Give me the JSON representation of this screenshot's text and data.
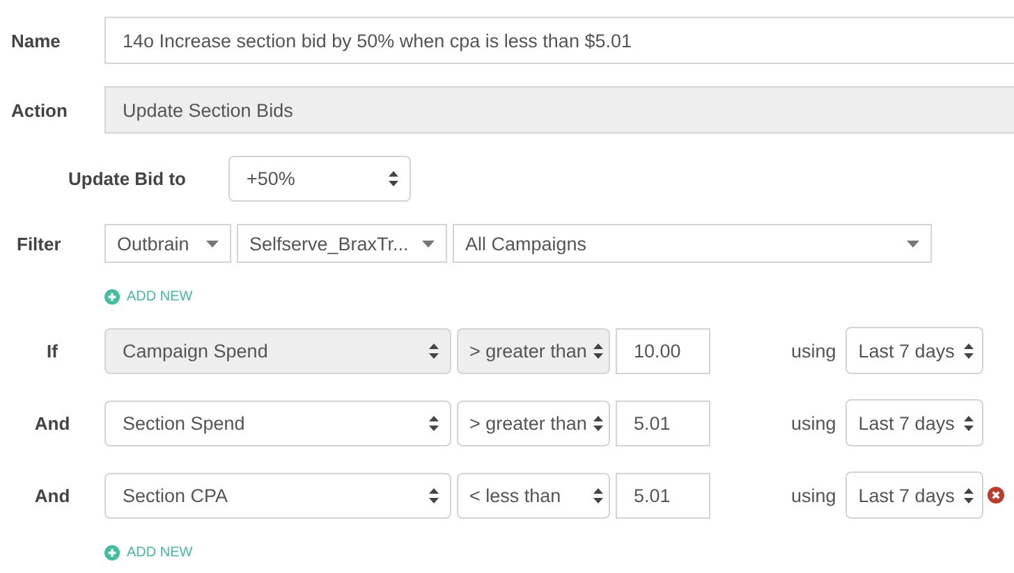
{
  "name": {
    "label": "Name",
    "value": "14o Increase section bid by 50% when cpa is less than $5.01"
  },
  "action": {
    "label": "Action",
    "value": "Update Section Bids",
    "disabled": true
  },
  "update_bid": {
    "label": "Update Bid to",
    "value": "+50%"
  },
  "filter": {
    "label": "Filter",
    "selects": [
      {
        "value": "Outbrain"
      },
      {
        "value": "Selfserve_BraxTr..."
      },
      {
        "value": "All Campaigns"
      }
    ],
    "add_new": "ADD NEW"
  },
  "conditions": [
    {
      "label": "If",
      "field": "Campaign Spend",
      "operator": "> greater than",
      "value": "10.00",
      "using": "using",
      "period": "Last 7 days",
      "disabled": true,
      "removable": false
    },
    {
      "label": "And",
      "field": "Section Spend",
      "operator": "> greater than",
      "value": "5.01",
      "using": "using",
      "period": "Last 7 days",
      "disabled": false,
      "removable": false
    },
    {
      "label": "And",
      "field": "Section CPA",
      "operator": "< less than",
      "value": "5.01",
      "using": "using",
      "period": "Last 7 days",
      "disabled": false,
      "removable": true
    }
  ],
  "add_new": "ADD NEW"
}
